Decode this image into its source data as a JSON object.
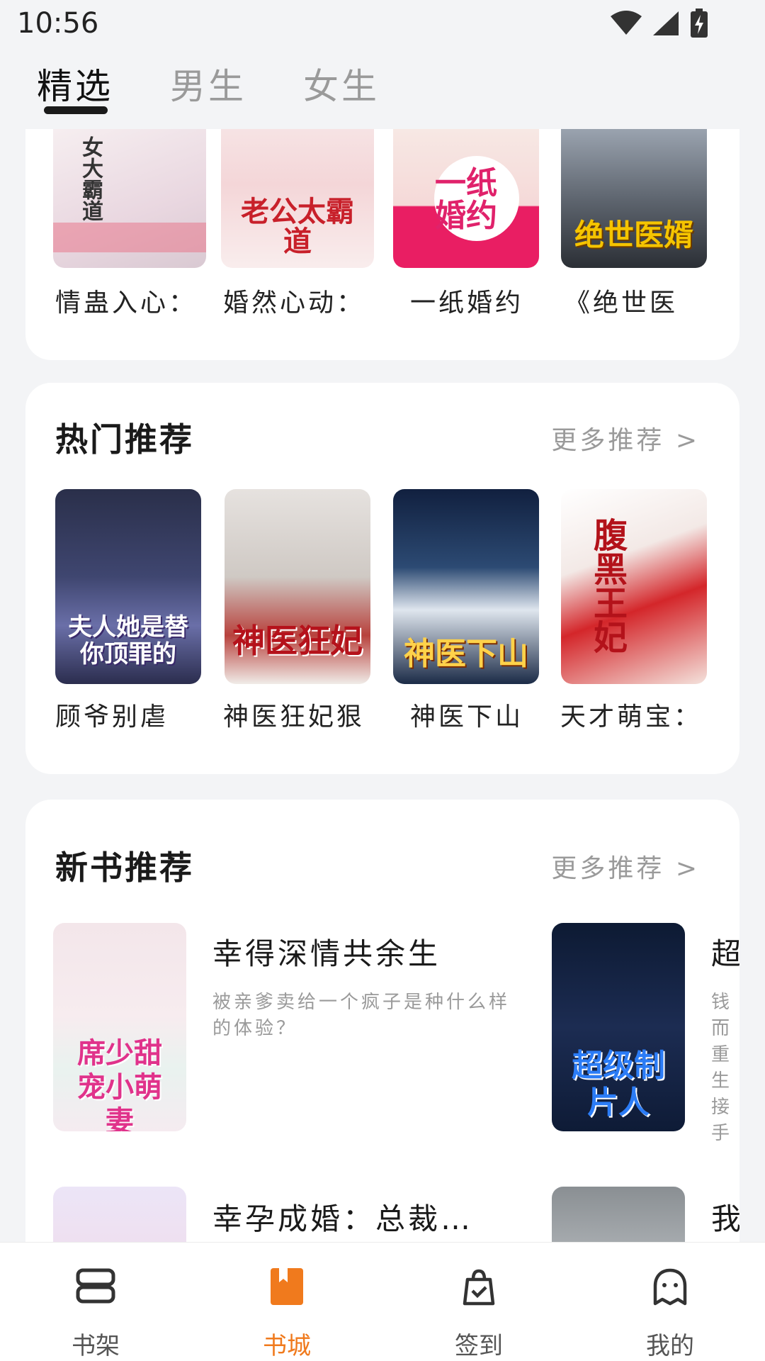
{
  "status": {
    "time": "10:56"
  },
  "tabs": [
    {
      "label": "精选"
    },
    {
      "label": "男生"
    },
    {
      "label": "女生"
    }
  ],
  "featured": {
    "books": [
      {
        "title": "情蛊入心：",
        "cover_text": "女大霸道"
      },
      {
        "title": "婚然心动：",
        "cover_text": "老公太霸道"
      },
      {
        "title": "一纸婚约",
        "cover_text": "一纸婚约"
      },
      {
        "title": "《绝世医",
        "cover_text": "绝世医婿"
      }
    ]
  },
  "hot": {
    "title": "热门推荐",
    "more": "更多推荐 >",
    "books": [
      {
        "title": "顾爷别虐",
        "cover_text": "夫人她是替你顶罪的"
      },
      {
        "title": "神医狂妃狠",
        "cover_text": "神医狂妃"
      },
      {
        "title": "神医下山",
        "cover_text": "神医下山"
      },
      {
        "title": "天才萌宝：",
        "cover_text": "腹黑王妃"
      }
    ]
  },
  "new": {
    "title": "新书推荐",
    "more": "更多推荐 >",
    "items": [
      {
        "title": "幸得深情共余生",
        "desc": "被亲爹卖给一个疯子是种什么样的体验？",
        "cover_text": "席少甜宠小萌妻"
      },
      {
        "title": "超",
        "desc": "钱而重生接手",
        "cover_text": "超级制片人"
      },
      {
        "title": "幸孕成婚：总裁…",
        "desc": "",
        "cover_text": ""
      },
      {
        "title": "我",
        "desc": "",
        "cover_text": ""
      }
    ]
  },
  "bottom_nav": [
    {
      "label": "书架"
    },
    {
      "label": "书城"
    },
    {
      "label": "签到"
    },
    {
      "label": "我的"
    }
  ],
  "colors": {
    "accent": "#f07a1d",
    "background": "#f3f4f6"
  }
}
